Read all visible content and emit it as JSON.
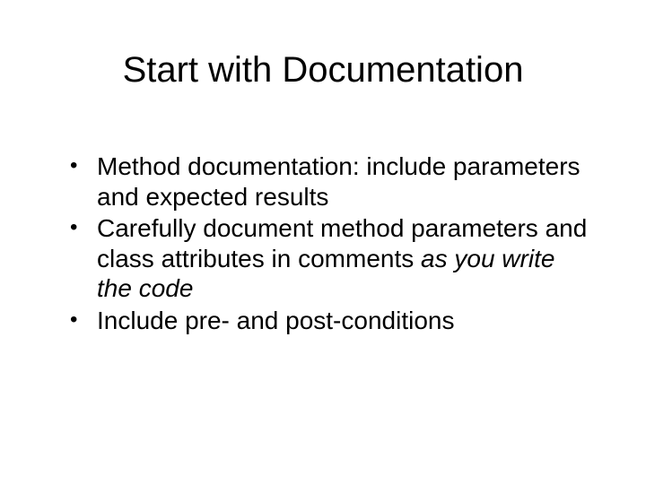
{
  "slide": {
    "title": "Start with Documentation",
    "bullets": [
      {
        "pre": "Method documentation:  include parameters and expected results",
        "italic": "",
        "post": ""
      },
      {
        "pre": "Carefully document method parameters and class attributes in comments ",
        "italic": "as you write the code",
        "post": ""
      },
      {
        "pre": "Include pre- and post-conditions",
        "italic": "",
        "post": ""
      }
    ]
  }
}
